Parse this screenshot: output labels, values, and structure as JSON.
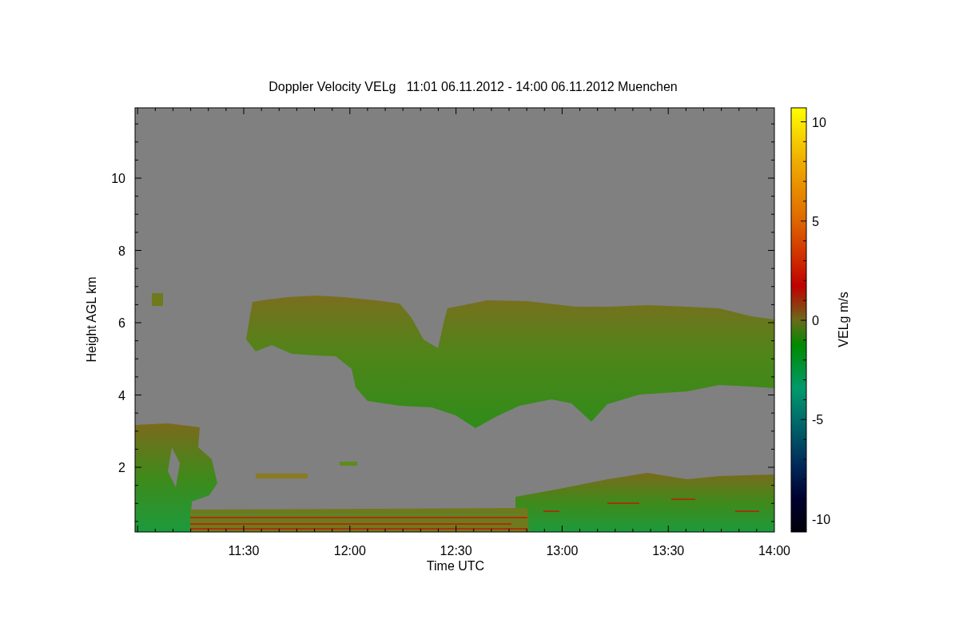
{
  "title": "Doppler Velocity VELg   11:01 06.11.2012 - 14:00 06.11.2012 Muenchen",
  "y_axis": {
    "label": "Height AGL km",
    "ticks": [
      "10",
      "8",
      "6",
      "4",
      "2"
    ]
  },
  "x_axis": {
    "label": "Time UTC",
    "ticks": [
      "11:30",
      "12:00",
      "12:30",
      "13:00",
      "13:30",
      "14:00"
    ]
  },
  "colorbar": {
    "label": "VELg m/s",
    "ticks": [
      "10",
      "5",
      "0",
      "-5",
      "-10"
    ]
  }
}
